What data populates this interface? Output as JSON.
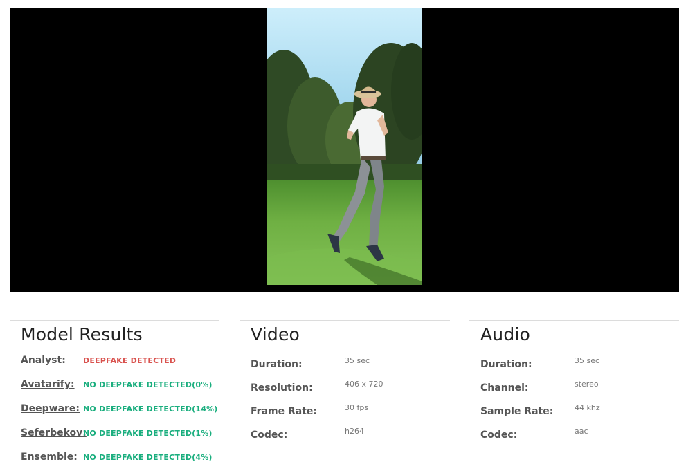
{
  "model_results": {
    "title": "Model Results",
    "rows": [
      {
        "name": "Analyst:",
        "status": "DEEPFAKE DETECTED",
        "kind": "fake"
      },
      {
        "name": "Avatarify:",
        "status": "NO DEEPFAKE DETECTED(0%)",
        "kind": "real"
      },
      {
        "name": "Deepware:",
        "status": "NO DEEPFAKE DETECTED(14%)",
        "kind": "real"
      },
      {
        "name": "Seferbekov:",
        "status": "NO DEEPFAKE DETECTED(1%)",
        "kind": "real"
      },
      {
        "name": "Ensemble:",
        "status": "NO DEEPFAKE DETECTED(4%)",
        "kind": "real"
      }
    ]
  },
  "video": {
    "title": "Video",
    "rows": [
      {
        "label": "Duration:",
        "value": "35 sec"
      },
      {
        "label": "Resolution:",
        "value": "406 x 720"
      },
      {
        "label": "Frame Rate:",
        "value": "30 fps"
      },
      {
        "label": "Codec:",
        "value": "h264"
      }
    ]
  },
  "audio": {
    "title": "Audio",
    "rows": [
      {
        "label": "Duration:",
        "value": "35 sec"
      },
      {
        "label": "Channel:",
        "value": "stereo"
      },
      {
        "label": "Sample Rate:",
        "value": "44 khz"
      },
      {
        "label": "Codec:",
        "value": "aac"
      }
    ]
  },
  "colors": {
    "fake": "#d9534f",
    "real": "#1aae7e",
    "player_background": "#000000"
  }
}
